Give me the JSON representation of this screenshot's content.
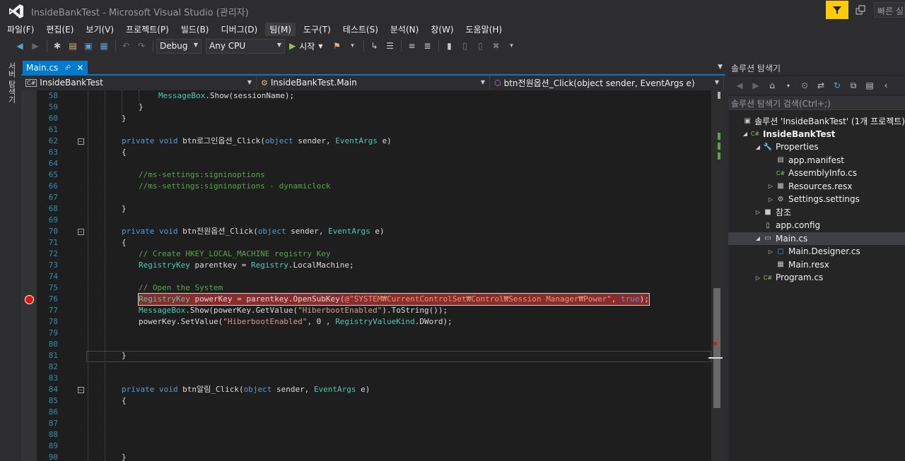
{
  "window": {
    "title": "InsideBankTest - Microsoft Visual Studio  (관리자)",
    "quick_launch_placeholder": "빠른 실"
  },
  "menu": [
    "파일(F)",
    "편집(E)",
    "보기(V)",
    "프로젝트(P)",
    "빌드(B)",
    "디버그(D)",
    "팀(M)",
    "도구(T)",
    "테스트(S)",
    "분석(N)",
    "창(W)",
    "도움말(H)"
  ],
  "toolbar": {
    "config": "Debug",
    "platform": "Any CPU",
    "start_label": "시작"
  },
  "left_strip_label": "서버 탐색기",
  "editor": {
    "tab_label": "Main.cs",
    "nav_project": "InsideBankTest",
    "nav_class": "InsideBankTest.Main",
    "nav_member": "btn전원옵션_Click(object sender, EventArgs e)",
    "lines": [
      {
        "n": "58",
        "text": "    MessageBox.Show(sessionName);"
      },
      {
        "n": "59",
        "text": "}"
      },
      {
        "n": "60",
        "text": "}"
      },
      {
        "n": "61",
        "text": ""
      },
      {
        "n": "62",
        "text": "private void btn로그인옵션_Click(object sender, EventArgs e)"
      },
      {
        "n": "63",
        "text": "{"
      },
      {
        "n": "64",
        "text": ""
      },
      {
        "n": "65",
        "text": "//ms-settings:signinoptions"
      },
      {
        "n": "66",
        "text": "//ms-settings:signinoptions - dynamiclock"
      },
      {
        "n": "67",
        "text": ""
      },
      {
        "n": "68",
        "text": "}"
      },
      {
        "n": "69",
        "text": ""
      },
      {
        "n": "70",
        "text": "private void btn전원옵션_Click(object sender, EventArgs e)"
      },
      {
        "n": "71",
        "text": "{"
      },
      {
        "n": "72",
        "text": "// Create HKEY_LOCAL_MACHINE registry Key"
      },
      {
        "n": "73",
        "text": "RegistryKey parentkey = Registry.LocalMachine;"
      },
      {
        "n": "74",
        "text": ""
      },
      {
        "n": "75",
        "text": "// Open the System"
      },
      {
        "n": "76",
        "text": "RegistryKey powerKey = parentkey.OpenSubKey(@\"SYSTEM₩CurrentControlSet₩Control₩Session Manager₩Power\", true);"
      },
      {
        "n": "77",
        "text": "MessageBox.Show(powerKey.GetValue(\"HiberbootEnabled\").ToString());"
      },
      {
        "n": "78",
        "text": "powerKey.SetValue(\"HiberbootEnabled\", 0 , RegistryValueKind.DWord);"
      },
      {
        "n": "79",
        "text": ""
      },
      {
        "n": "80",
        "text": ""
      },
      {
        "n": "81",
        "text": "}"
      },
      {
        "n": "82",
        "text": ""
      },
      {
        "n": "83",
        "text": ""
      },
      {
        "n": "84",
        "text": "private void btn알림_Click(object sender, EventArgs e)"
      },
      {
        "n": "85",
        "text": "{"
      },
      {
        "n": "86",
        "text": ""
      },
      {
        "n": "87",
        "text": ""
      },
      {
        "n": "88",
        "text": ""
      },
      {
        "n": "89",
        "text": ""
      },
      {
        "n": "90",
        "text": "}"
      }
    ]
  },
  "solution_explorer": {
    "title": "솔루션 탐색기",
    "search_placeholder": "솔루션 탐색기 검색(Ctrl+;)",
    "items": [
      {
        "label": "솔루션 'InsideBankTest' (1개 프로젝트)",
        "icon": "solution-icon"
      },
      {
        "label": "InsideBankTest",
        "icon": "csharp-project-icon"
      },
      {
        "label": "Properties",
        "icon": "wrench-icon"
      },
      {
        "label": "app.manifest",
        "icon": "manifest-icon"
      },
      {
        "label": "AssemblyInfo.cs",
        "icon": "csharp-file-icon"
      },
      {
        "label": "Resources.resx",
        "icon": "resx-icon"
      },
      {
        "label": "Settings.settings",
        "icon": "settings-gear-icon"
      },
      {
        "label": "참조",
        "icon": "references-icon"
      },
      {
        "label": "app.config",
        "icon": "config-icon"
      },
      {
        "label": "Main.cs",
        "icon": "form-icon"
      },
      {
        "label": "Main.Designer.cs",
        "icon": "designer-file-icon"
      },
      {
        "label": "Main.resx",
        "icon": "resx-icon"
      },
      {
        "label": "Program.cs",
        "icon": "csharp-file-icon"
      }
    ]
  },
  "colors": {
    "accent": "#007acc",
    "breakpoint": "#e51400",
    "keyword": "#569cd6",
    "type": "#4ec9b0",
    "comment": "#57a64a",
    "string": "#d69d85"
  }
}
